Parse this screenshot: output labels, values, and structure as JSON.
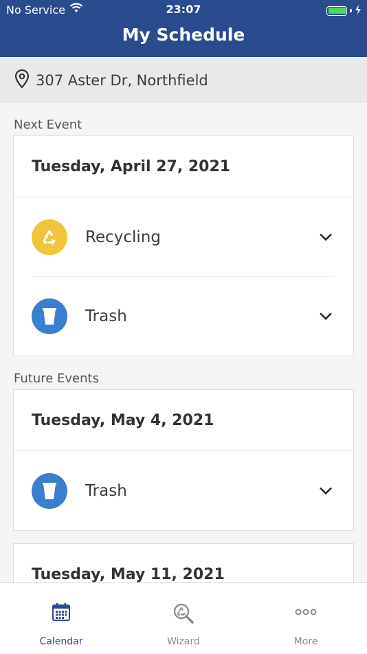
{
  "status_bar": {
    "carrier": "No Service",
    "time": "23:07"
  },
  "header": {
    "title": "My Schedule"
  },
  "address": "307 Aster Dr, Northfield",
  "next_event": {
    "label": "Next Event",
    "date": "Tuesday, April 27, 2021",
    "items": [
      {
        "label": "Recycling",
        "icon": "recycle-icon",
        "color": "#f0c53d"
      },
      {
        "label": "Trash",
        "icon": "trash-can-icon",
        "color": "#3b7ed0"
      }
    ]
  },
  "future_events": {
    "label": "Future Events",
    "cards": [
      {
        "date": "Tuesday, May 4, 2021",
        "items": [
          {
            "label": "Trash",
            "icon": "trash-can-icon",
            "color": "#3b7ed0"
          }
        ]
      },
      {
        "date": "Tuesday, May 11, 2021"
      }
    ]
  },
  "tab_bar": {
    "tabs": [
      {
        "label": "Calendar",
        "icon": "calendar-icon",
        "active": true
      },
      {
        "label": "Wizard",
        "icon": "magnifier-recycle-icon",
        "active": false
      },
      {
        "label": "More",
        "icon": "more-dots-icon",
        "active": false
      }
    ]
  },
  "colors": {
    "primary": "#2a4b8d",
    "recycling": "#f0c53d",
    "trash": "#3b7ed0",
    "tab_active": "#2a4b8d",
    "tab_inactive": "#8a8a8a"
  }
}
